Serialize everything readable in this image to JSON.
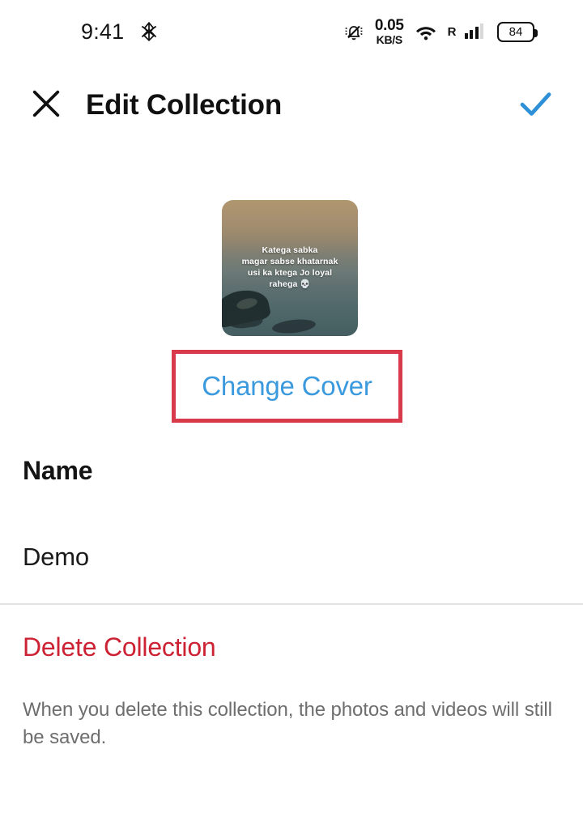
{
  "status_bar": {
    "time": "9:41",
    "dnd_icon": "asterisk-star-icon",
    "bell_icon": "bell-muted-icon",
    "network_speed_value": "0.05",
    "network_speed_unit": "KB/S",
    "wifi_icon": "wifi-icon",
    "roaming_label": "R",
    "signal_icon": "signal-bars-icon",
    "battery_level": "84"
  },
  "header": {
    "close_icon": "close-x-icon",
    "title": "Edit Collection",
    "confirm_icon": "checkmark-icon",
    "accent_color": "#3b9ade"
  },
  "cover": {
    "caption_line1": "Katega sabka",
    "caption_line2": "magar sabse khatarnak",
    "caption_line3": "usi ka ktega Jo loyal",
    "caption_line4": "rahega 💀",
    "change_cover_label": "Change Cover",
    "change_cover_color": "#3b9ade"
  },
  "annotation": {
    "highlight_color": "#d83a4c",
    "target": "Change Cover"
  },
  "name_field": {
    "label": "Name",
    "value": "Demo"
  },
  "delete_section": {
    "title": "Delete Collection",
    "title_color": "#cc2233",
    "description": "When you delete this collection, the photos and videos will still be saved."
  }
}
